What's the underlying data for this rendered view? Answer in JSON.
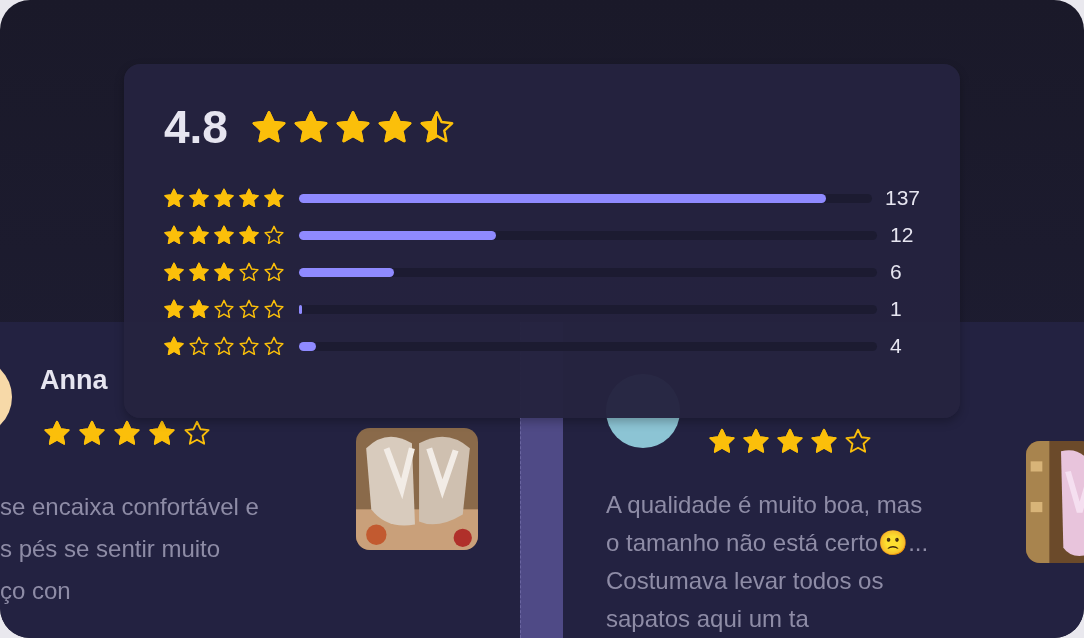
{
  "summary": {
    "average": "4.8",
    "stars": 4.5,
    "breakdown": [
      {
        "stars": 5,
        "level": 0.92,
        "count": "137"
      },
      {
        "stars": 4,
        "level": 0.34,
        "count": "12"
      },
      {
        "stars": 3,
        "level": 0.165,
        "count": "6"
      },
      {
        "stars": 2,
        "level": 0.006,
        "count": "1"
      },
      {
        "stars": 1,
        "level": 0.03,
        "count": "4"
      }
    ]
  },
  "reviews": [
    {
      "name": "Anna",
      "stars": 4,
      "color": "#f7d9a8",
      "lines": [
        "se encaixa confortável e",
        "s pés se sentir muito",
        "ço con"
      ],
      "photo": {
        "kind": "picture"
      }
    },
    {
      "stars": 4,
      "color": "#8cc4d4",
      "lines": [
        "A qualidade é muito boa, mas",
        "o tamanho não está certo🙁...",
        "Costumava levar todos os",
        "sapatos aqui um ta"
      ],
      "photo": {
        "kind": "picture"
      }
    }
  ]
}
